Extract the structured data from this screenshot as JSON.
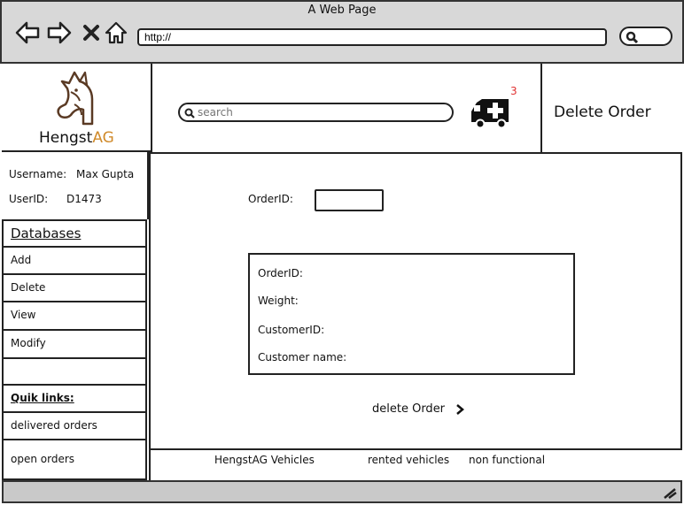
{
  "browser": {
    "window_title": "A Web Page",
    "url": "http://"
  },
  "header": {
    "logo_text_main": "Hengst",
    "logo_text_accent": "AG",
    "search_placeholder": "search",
    "notification_count": "3",
    "page_title": "Delete Order"
  },
  "user": {
    "username_label": "Username:",
    "username_value": "Max Gupta",
    "userid_label": "UserID:",
    "userid_value": "D1473"
  },
  "sidebar": {
    "databases_heading": "Databases",
    "items": [
      "Add",
      "Delete",
      "View",
      "Modify"
    ],
    "quicklinks_heading": "Quik links:",
    "quicklinks": [
      "delivered orders",
      "open orders"
    ]
  },
  "form": {
    "orderid_label": "OrderID:",
    "orderid_value": ""
  },
  "details": {
    "fields": [
      "OrderID:",
      "Weight:",
      "CustomerID:",
      "Customer name:"
    ]
  },
  "actions": {
    "delete_label": "delete Order"
  },
  "footer": {
    "links": [
      "HengstAG Vehicles",
      "rented vehicles",
      "non functional"
    ]
  },
  "colors": {
    "accent": "#d08a2a",
    "badge": "#e03030",
    "chrome": "#d8d8d8"
  },
  "icons": [
    "back-arrow-icon",
    "forward-arrow-icon",
    "close-icon",
    "home-icon",
    "search-icon",
    "horse-logo-icon",
    "delivery-van-icon",
    "chevron-right-icon",
    "resize-grip-icon"
  ]
}
